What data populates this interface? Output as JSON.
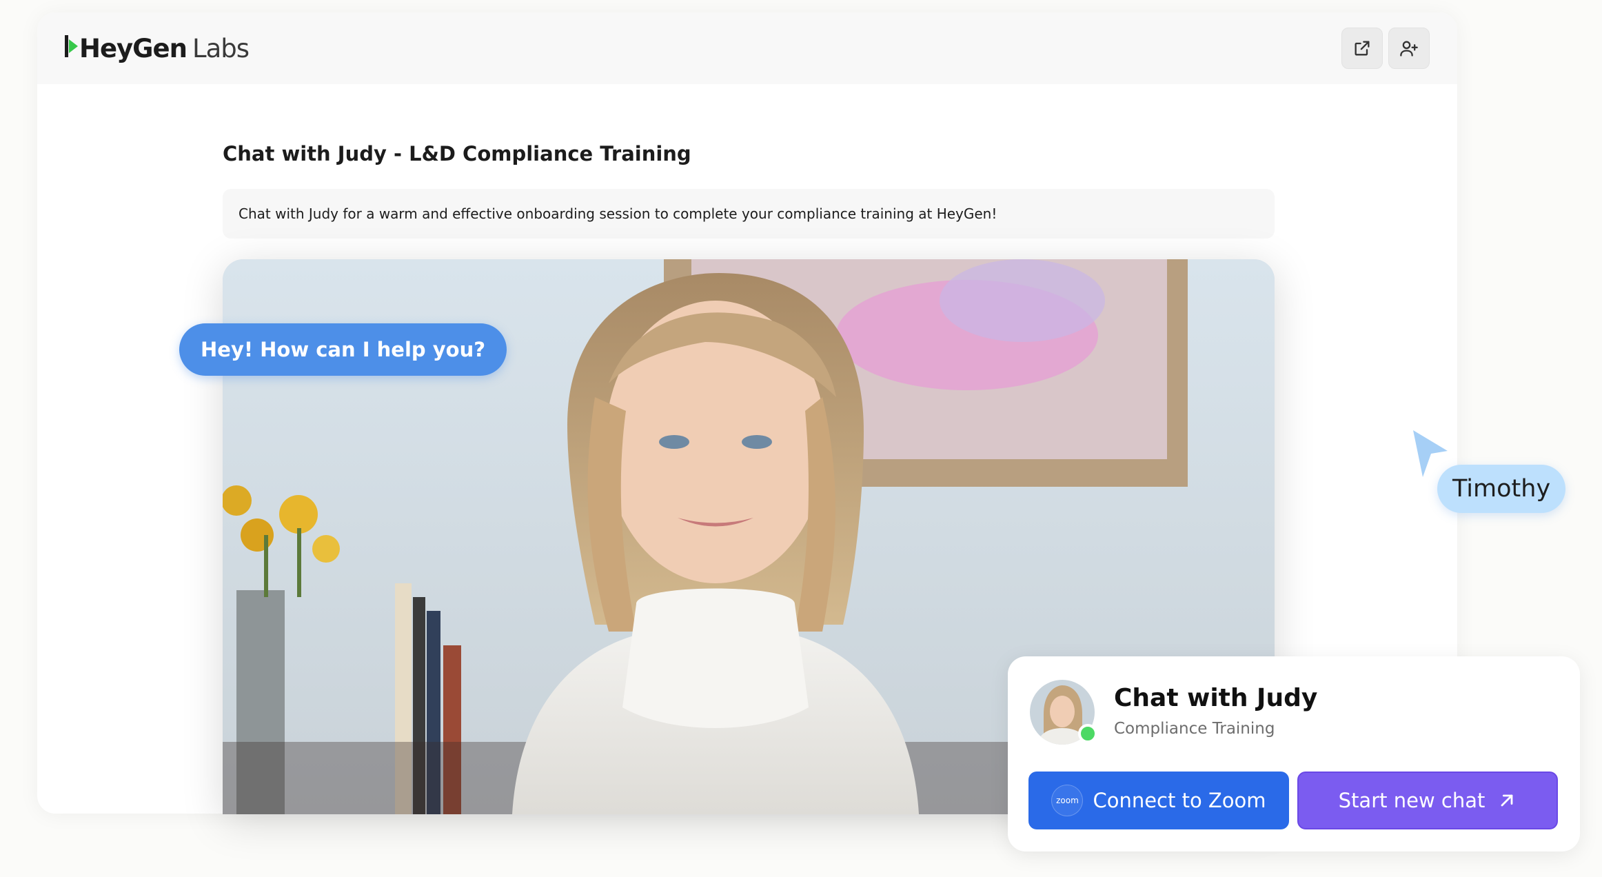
{
  "header": {
    "logo_main": "HeyGen",
    "logo_sub": "Labs",
    "actions": [
      {
        "icon": "external-link-icon"
      },
      {
        "icon": "add-user-icon"
      }
    ]
  },
  "main": {
    "title": "Chat with Judy - L&D Compliance Training",
    "description": "Chat with Judy for a warm and effective onboarding session to complete your compliance training at HeyGen!"
  },
  "video": {
    "speech_bubble": "Hey! How can I help you?"
  },
  "cursor": {
    "label": "Timothy"
  },
  "chat_card": {
    "title": "Chat with Judy",
    "subtitle": "Compliance Training",
    "zoom_logo_text": "zoom",
    "zoom_button_label": "Connect to Zoom",
    "new_chat_button_label": "Start new chat"
  },
  "colors": {
    "zoom_blue": "#2a6ae8",
    "new_chat_purple": "#7b5cf0",
    "speech_blue": "#4d8fe8",
    "cursor_blue": "#bde0fd",
    "online_green": "#4cd964",
    "logo_green": "#37c84a"
  }
}
